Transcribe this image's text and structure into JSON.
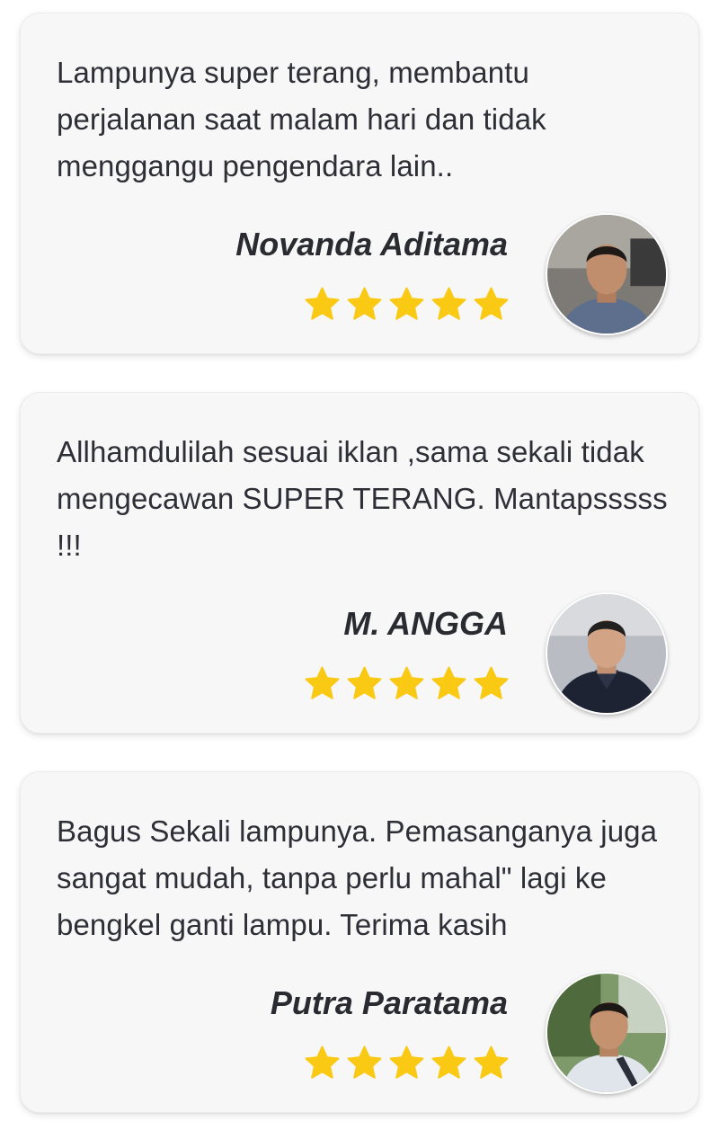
{
  "colors": {
    "star": "#f9c914",
    "card_background": "#f7f7f8",
    "text": "#2e2f36"
  },
  "reviews": [
    {
      "text": "Lampunya super terang, membantu perjalanan saat malam hari dan tidak menggangu pengendara lain..",
      "name": "Novanda Aditama",
      "rating": 5,
      "avatar_icon": "user-photo-icon"
    },
    {
      "text": "Allhamdulilah sesuai iklan ,sama sekali tidak mengecawan SUPER TERANG. Mantapsssss !!!",
      "name": "M. ANGGA",
      "rating": 5,
      "avatar_icon": "user-photo-icon"
    },
    {
      "text": "Bagus Sekali lampunya. Pemasanganya juga sangat mudah, tanpa perlu mahal\" lagi ke bengkel ganti lampu. Terima kasih",
      "name": "Putra Paratama",
      "rating": 5,
      "avatar_icon": "user-photo-icon"
    }
  ]
}
